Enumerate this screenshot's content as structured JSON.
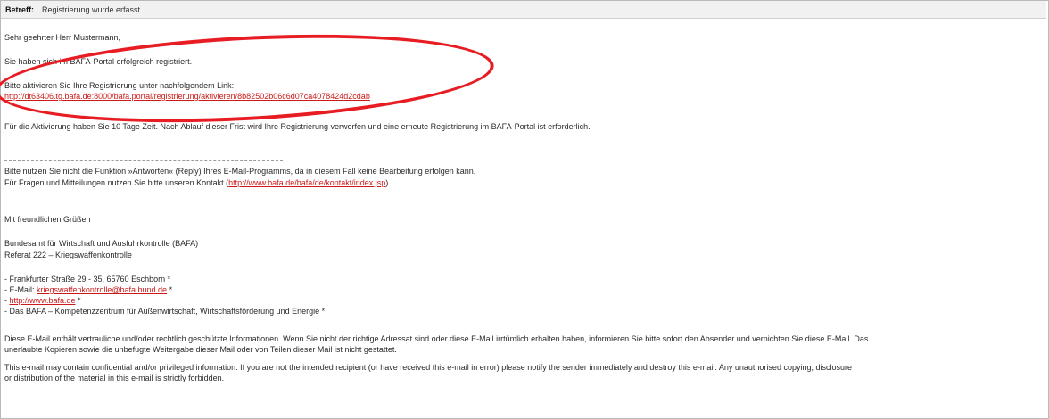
{
  "subject": {
    "label": "Betreff:",
    "value": "Registrierung wurde erfasst"
  },
  "body": {
    "greeting": "Sehr geehrter Herr Mustermann,",
    "registered": "Sie haben sich im BAFA-Portal erfolgreich registriert.",
    "activate_prompt": "Bitte aktivieren Sie Ihre Registrierung unter nachfolgendem Link:",
    "activation_link": "http://dt63406.tg.bafa.de:8000/bafa.portal/registrierung/aktivieren/8b82502b06c6d07ca4078424d2cdab",
    "deadline": "Für die Aktivierung haben Sie 10 Tage Zeit. Nach Ablauf dieser Frist wird Ihre Registrierung verworfen und eine erneute Registrierung im BAFA-Portal ist erforderlich.",
    "noreply": "Bitte nutzen Sie nicht die Funktion »Antworten« (Reply) Ihres E-Mail-Programms, da in diesem Fall keine Bearbeitung erfolgen kann.",
    "contact_prefix": "Für Fragen und Mitteilungen nutzen Sie bitte unseren Kontakt (",
    "contact_link": "http://www.bafa.de/bafa/de/kontakt/index.jsp",
    "contact_suffix": ").",
    "closing": "Mit freundlichen Grüßen",
    "org_name": "Bundesamt für Wirtschaft und Ausfuhrkontrolle (BAFA)",
    "org_unit": "Referat 222 – Kriegswaffenkontrolle",
    "address": " - Frankfurter Straße 29 - 35, 65760 Eschborn *",
    "email_prefix": " - E-Mail: ",
    "email_link": "kriegswaffenkontrolle@bafa.bund.de",
    "email_suffix": " *",
    "web_prefix": " - ",
    "web_link": "http://www.bafa.de",
    "web_suffix": " *",
    "slogan": " - Das BAFA – Kompetenzzentrum für Außenwirtschaft, Wirtschaftsförderung und Energie *",
    "disclaimer_de_1": "Diese E-Mail enthält vertrauliche und/oder rechtlich geschützte Informationen. Wenn Sie nicht der richtige Adressat sind oder diese E-Mail irrtümlich erhalten haben, informieren Sie bitte sofort den Absender und vernichten Sie diese E-Mail. Das",
    "disclaimer_de_2": "unerlaubte Kopieren sowie die unbefugte Weitergabe dieser Mail oder von Teilen dieser Mail ist nicht gestattet.",
    "disclaimer_en_1": "This e-mail may contain confidential and/or privileged information. If you are not the intended recipient (or have received this e-mail in error) please notify the sender immediately and destroy this e-mail. Any unauthorised copying, disclosure",
    "disclaimer_en_2": "or distribution of the material in this e-mail is strictly forbidden."
  },
  "colors": {
    "link": "#cc1a1a",
    "highlight": "#e81d24"
  }
}
